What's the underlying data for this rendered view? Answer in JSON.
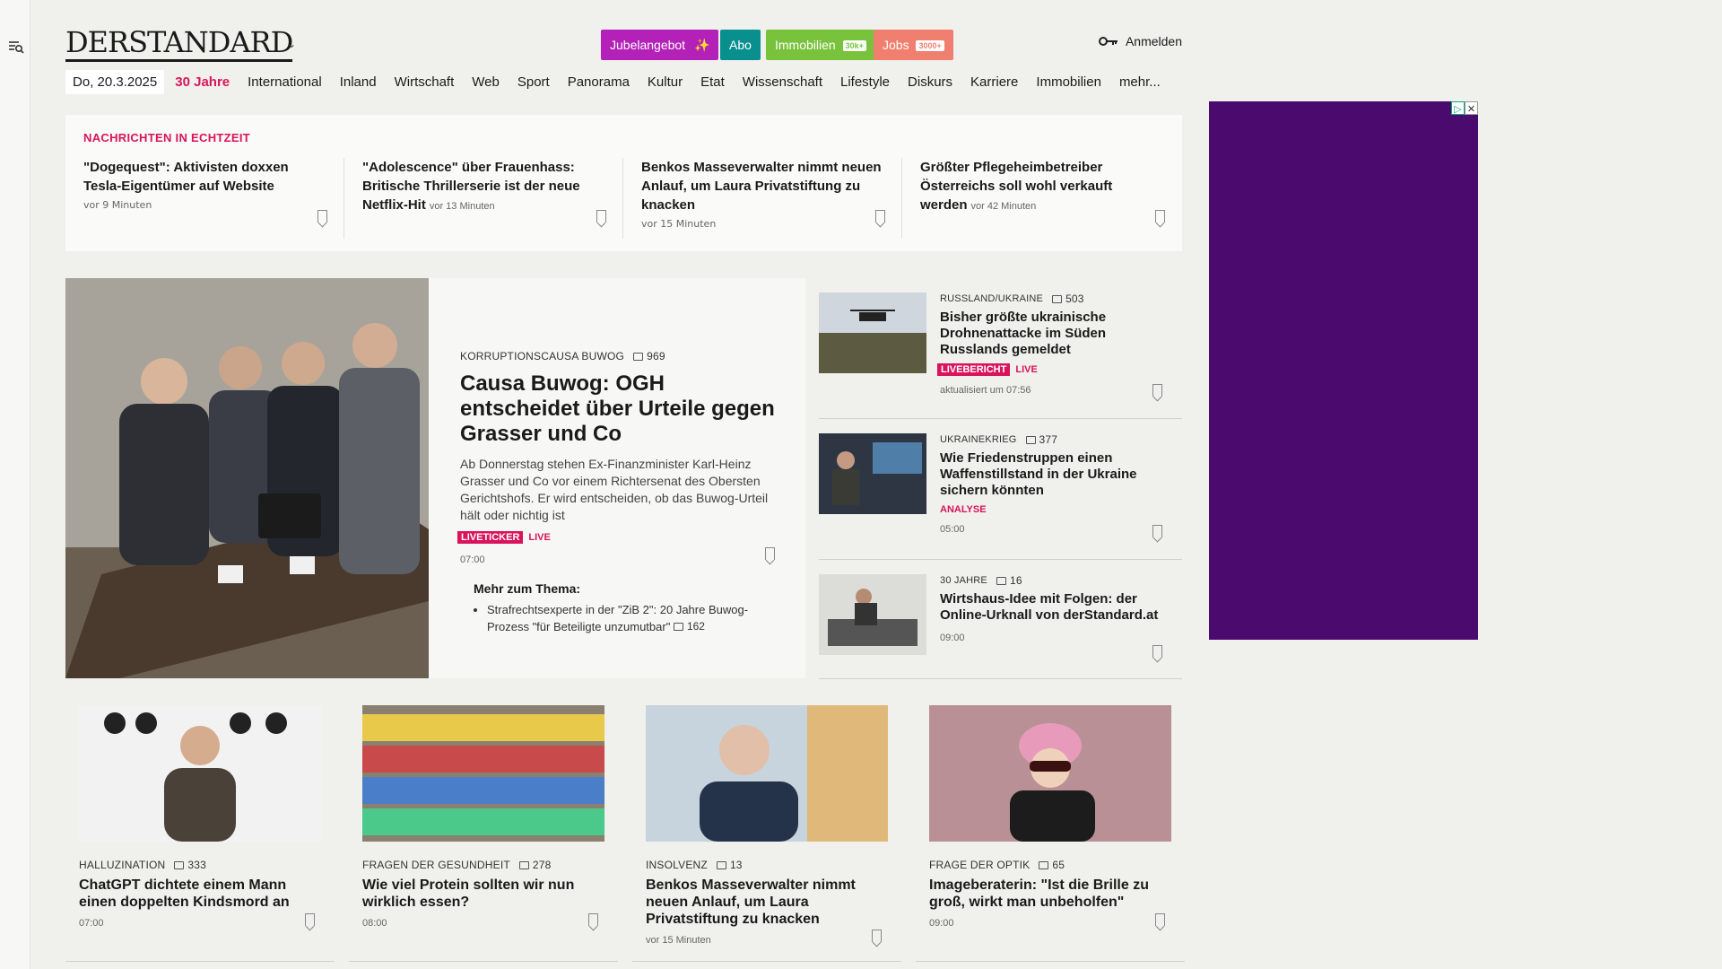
{
  "header": {
    "logo": "DERSTANDARD",
    "pills": [
      {
        "label": "Jubelangebot",
        "color": "#b321b8",
        "icon": "sparkle-icon"
      },
      {
        "label": "Abo",
        "color": "#0a8f8f"
      },
      {
        "label": "Immobilien",
        "tag": "30k+",
        "color": "#79c23b"
      },
      {
        "label": "Jobs",
        "tag": "3000+",
        "color": "#f07f6f"
      }
    ],
    "login_label": "Anmelden"
  },
  "nav": {
    "date": "Do, 20.3.2025",
    "items": [
      "30 Jahre",
      "International",
      "Inland",
      "Wirtschaft",
      "Web",
      "Sport",
      "Panorama",
      "Kultur",
      "Etat",
      "Wissenschaft",
      "Lifestyle",
      "Diskurs",
      "Karriere",
      "Immobilien",
      "mehr..."
    ]
  },
  "ticker": {
    "title": "NACHRICHTEN IN ECHTZEIT",
    "items": [
      {
        "headline": "\"Dogequest\": Aktivisten doxxen Tesla-Eigentümer auf Website",
        "time": "vor 9 Minuten"
      },
      {
        "headline": "\"Adolescence\" über Frauenhass: Britische Thrillerserie ist der neue Netflix-Hit",
        "time": "vor 13 Minuten"
      },
      {
        "headline": "Benkos Masseverwalter nimmt neuen Anlauf, um Laura Privatstiftung zu knacken",
        "time": "vor 15 Minuten"
      },
      {
        "headline": "Größter Pflegeheimbetreiber Österreichs soll wohl verkauft werden",
        "time": "vor 42 Minuten"
      }
    ]
  },
  "hero": {
    "kicker": "KORRUPTIONSCAUSA BUWOG",
    "comments": "969",
    "title": "Causa Buwog: OGH entscheidet über Urteile gegen Grasser und Co",
    "lead": "Ab Donnerstag stehen Ex-Finanzminister Karl-Heinz Grasser und Co vor einem Richtersenat des Obersten Gerichtshofs. Er wird entscheiden, ob das Buwog-Urteil hält oder nichtig ist",
    "badge": "LIVETICKER",
    "live": "LIVE",
    "time": "07:00",
    "more_title": "Mehr zum Thema:",
    "more_item": "Strafrechtsexperte in der \"ZiB 2\": 20 Jahre Buwog-Prozess \"für Beteiligte unzumutbar\"",
    "more_comments": "162"
  },
  "side": [
    {
      "kicker": "RUSSLAND/UKRAINE",
      "comments": "503",
      "title": "Bisher größte ukrainische Drohnenattacke im Süden Russlands gemeldet",
      "badge": "LIVEBERICHT",
      "live": "LIVE",
      "meta": "aktualisiert um 07:56"
    },
    {
      "kicker": "UKRAINEKRIEG",
      "comments": "377",
      "title": "Wie Friedenstruppen einen Waffenstillstand in der Ukraine sichern könnten",
      "analysis": "ANALYSE",
      "meta": "05:00"
    },
    {
      "kicker": "30 JAHRE",
      "comments": "16",
      "title": "Wirtshaus-Idee mit Folgen: der Online-Urknall von derStandard.at",
      "meta": "09:00"
    }
  ],
  "cards": [
    {
      "kicker": "HALLUZINATION",
      "comments": "333",
      "title": "ChatGPT dichtete einem Mann einen doppelten Kindsmord an",
      "meta": "07:00"
    },
    {
      "kicker": "FRAGEN DER GESUNDHEIT",
      "comments": "278",
      "title": "Wie viel Protein sollten wir nun wirklich essen?",
      "meta": "08:00"
    },
    {
      "kicker": "INSOLVENZ",
      "comments": "13",
      "title": "Benkos Masseverwalter nimmt neuen Anlauf, um Laura Privatstiftung zu knacken",
      "meta": "vor 15 Minuten"
    },
    {
      "kicker": "FRAGE DER OPTIK",
      "comments": "65",
      "title": "Imageberaterin: \"Ist die Brille zu groß, wirkt man unbeholfen\"",
      "meta": "09:00"
    }
  ],
  "colors": {
    "accent": "#d9145c",
    "ad_bg": "#4a0a6e"
  }
}
